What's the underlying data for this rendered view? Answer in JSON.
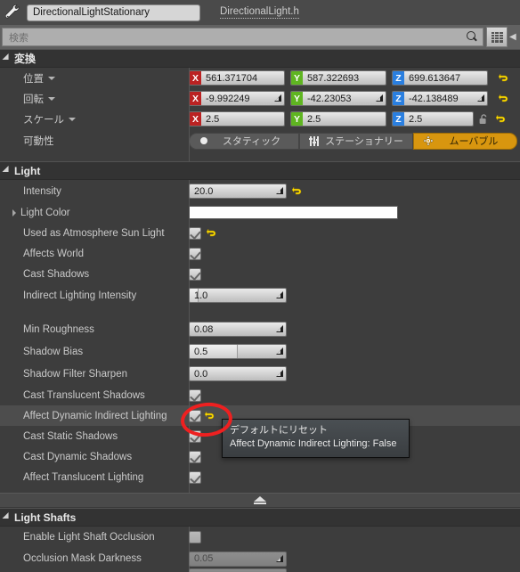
{
  "header": {
    "icon": "wrench-icon",
    "actor_name": "DirectionalLightStationary",
    "source_link": "DirectionalLight.h"
  },
  "search": {
    "placeholder": "検索",
    "value": "",
    "search_icon": "magnifier-icon",
    "view_button_icon": "grid-view-icon",
    "overflow_icon": "chevron-right-icon"
  },
  "transform": {
    "title": "変換",
    "rows": [
      {
        "label": "位置",
        "has_dropdown": true,
        "x": "561.371704",
        "y": "587.322693",
        "z": "699.613647",
        "spinners": false,
        "reset": true
      },
      {
        "label": "回転",
        "has_dropdown": true,
        "x": "-9.992249",
        "y": "-42.23053",
        "z": "-42.138489",
        "spinners": true,
        "reset": true
      },
      {
        "label": "スケール",
        "has_dropdown": true,
        "x": "2.5",
        "y": "2.5",
        "z": "2.5",
        "spinners": false,
        "reset": true,
        "lock_icon": "unlocked-padlock-icon"
      }
    ],
    "mobility": {
      "label": "可動性",
      "options": [
        {
          "label": "スタティック",
          "icon": "dot-icon",
          "active": false
        },
        {
          "label": "ステーショナリー",
          "icon": "sliders-icon",
          "active": false
        },
        {
          "label": "ムーバブル",
          "icon": "move-arrows-icon",
          "active": true
        }
      ],
      "active_color": "#d8960f"
    }
  },
  "light": {
    "title": "Light",
    "rows": [
      {
        "label": "Intensity",
        "type": "number",
        "value": "20.0",
        "fill_pct": 0,
        "reset": true
      },
      {
        "label": "Light Color",
        "type": "color",
        "value": "#ffffff",
        "expandable": true
      },
      {
        "label": "Used as Atmosphere Sun Light",
        "type": "checkbox",
        "checked": true,
        "reset": true
      },
      {
        "label": "Affects World",
        "type": "checkbox",
        "checked": true
      },
      {
        "label": "Cast Shadows",
        "type": "checkbox",
        "checked": true
      },
      {
        "label": "Indirect Lighting Intensity",
        "type": "number",
        "value": "1.0",
        "fill_pct": 9
      }
    ],
    "rows2": [
      {
        "label": "Min Roughness",
        "type": "number",
        "value": "0.08",
        "fill_pct": 0
      },
      {
        "label": "Shadow Bias",
        "type": "number",
        "value": "0.5",
        "fill_pct": 50
      },
      {
        "label": "Shadow Filter Sharpen",
        "type": "number",
        "value": "0.0",
        "fill_pct": 0
      },
      {
        "label": "Cast Translucent Shadows",
        "type": "checkbox",
        "checked": true
      },
      {
        "label": "Affect Dynamic Indirect Lighting",
        "type": "checkbox",
        "checked": true,
        "reset": true,
        "highlighted": true
      },
      {
        "label": "Cast Static Shadows",
        "type": "checkbox",
        "checked": true
      },
      {
        "label": "Cast Dynamic Shadows",
        "type": "checkbox",
        "checked": true
      },
      {
        "label": "Affect Translucent Lighting",
        "type": "checkbox",
        "checked": true
      }
    ]
  },
  "expand_bar": {
    "icon": "collapse-up-icon"
  },
  "light_shafts": {
    "title": "Light Shafts",
    "rows": [
      {
        "label": "Enable Light Shaft Occlusion",
        "type": "checkbox",
        "checked": false
      },
      {
        "label": "Occlusion Mask Darkness",
        "type": "number",
        "value": "0.05",
        "disabled": true
      }
    ]
  },
  "tooltip": {
    "line1": "デフォルトにリセット",
    "line2": "Affect Dynamic Indirect Lighting: False"
  },
  "annotation": {
    "shape": "red-ellipse-highlight",
    "color": "#ee2020"
  }
}
